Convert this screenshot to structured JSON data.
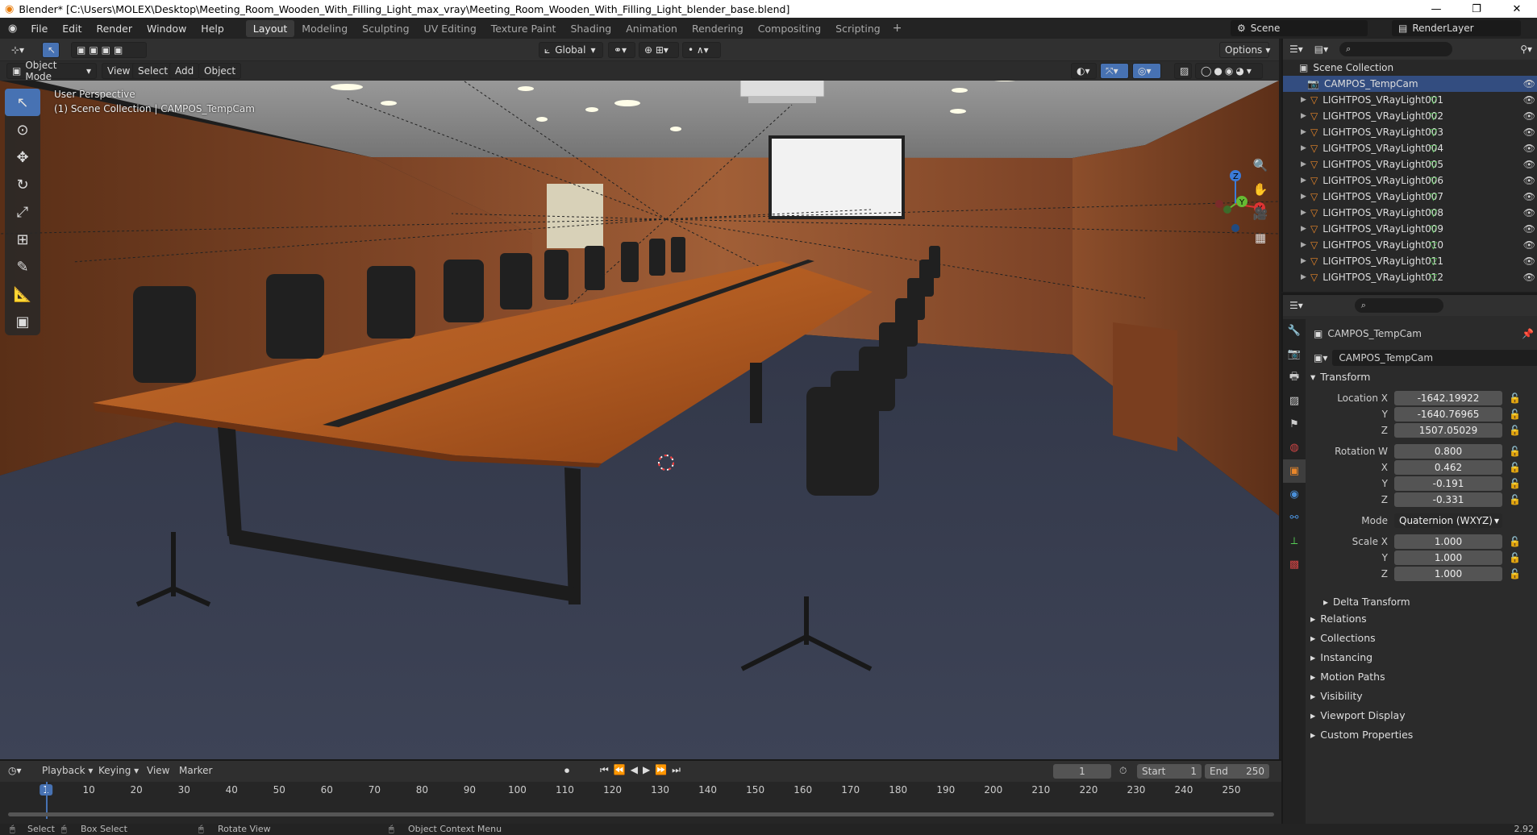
{
  "window": {
    "title": "Blender* [C:\\Users\\MOLEX\\Desktop\\Meeting_Room_Wooden_With_Filling_Light_max_vray\\Meeting_Room_Wooden_With_Filling_Light_blender_base.blend]",
    "minimize": "—",
    "maximize": "❐",
    "close": "✕"
  },
  "menus": [
    "File",
    "Edit",
    "Render",
    "Window",
    "Help"
  ],
  "workspaces": [
    "Layout",
    "Modeling",
    "Sculpting",
    "UV Editing",
    "Texture Paint",
    "Shading",
    "Animation",
    "Rendering",
    "Compositing",
    "Scripting"
  ],
  "active_workspace": "Layout",
  "scene_name": "Scene",
  "render_layer": "RenderLayer",
  "viewport": {
    "transform_orientation": "Global",
    "options_label": "Options",
    "mode": "Object Mode",
    "header_menus": [
      "View",
      "Select",
      "Add",
      "Object"
    ],
    "overlay_line1": "User Perspective",
    "overlay_line2": "(1) Scene Collection | CAMPOS_TempCam",
    "gizmo": {
      "x": "X",
      "y": "Y",
      "z": "Z"
    }
  },
  "outliner": {
    "root": "Scene Collection",
    "items": [
      {
        "name": "CAMPOS_TempCam",
        "selected": true
      },
      {
        "name": "LIGHTPOS_VRayLight001"
      },
      {
        "name": "LIGHTPOS_VRayLight002"
      },
      {
        "name": "LIGHTPOS_VRayLight003"
      },
      {
        "name": "LIGHTPOS_VRayLight004"
      },
      {
        "name": "LIGHTPOS_VRayLight005"
      },
      {
        "name": "LIGHTPOS_VRayLight006"
      },
      {
        "name": "LIGHTPOS_VRayLight007"
      },
      {
        "name": "LIGHTPOS_VRayLight008"
      },
      {
        "name": "LIGHTPOS_VRayLight009"
      },
      {
        "name": "LIGHTPOS_VRayLight010"
      },
      {
        "name": "LIGHTPOS_VRayLight011"
      },
      {
        "name": "LIGHTPOS_VRayLight012"
      }
    ]
  },
  "properties": {
    "object_name": "CAMPOS_TempCam",
    "object_data_name": "CAMPOS_TempCam",
    "transform_header": "Transform",
    "location": {
      "label": "Location X",
      "x": "-1642.19922",
      "y": "-1640.76965",
      "z": "1507.05029"
    },
    "rotation": {
      "label": "Rotation W",
      "w": "0.800",
      "x": "0.462",
      "y": "-0.191",
      "z": "-0.331"
    },
    "axis_labels": {
      "x": "X",
      "y": "Y",
      "z": "Z"
    },
    "mode_label": "Mode",
    "mode_value": "Quaternion (WXYZ)",
    "scale": {
      "label": "Scale X",
      "x": "1.000",
      "y": "1.000",
      "z": "1.000"
    },
    "delta_transform": "Delta Transform",
    "sections": [
      "Relations",
      "Collections",
      "Instancing",
      "Motion Paths",
      "Visibility",
      "Viewport Display",
      "Custom Properties"
    ]
  },
  "timeline": {
    "menus": [
      "Playback",
      "Keying",
      "View",
      "Marker"
    ],
    "current_frame": "1",
    "start_label": "Start",
    "start": "1",
    "end_label": "End",
    "end": "250",
    "ticks": [
      "1",
      "10",
      "20",
      "30",
      "40",
      "50",
      "60",
      "70",
      "80",
      "90",
      "100",
      "110",
      "120",
      "130",
      "140",
      "150",
      "160",
      "170",
      "180",
      "190",
      "200",
      "210",
      "220",
      "230",
      "240",
      "250"
    ]
  },
  "status": {
    "select": "Select",
    "box_select": "Box Select",
    "rotate_view": "Rotate View",
    "context_menu": "Object Context Menu",
    "version": "2.92"
  }
}
